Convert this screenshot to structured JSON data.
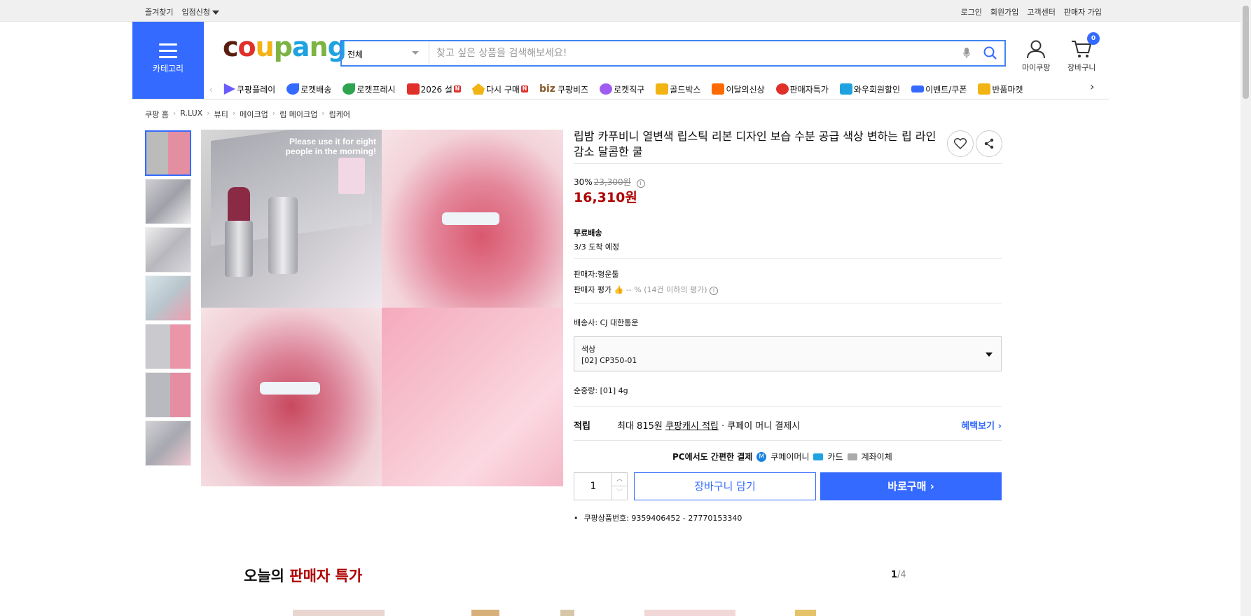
{
  "topbar": {
    "favorites": "즐겨찾기",
    "partner": "입점신청",
    "login": "로그인",
    "signup": "회원가입",
    "cs": "고객센터",
    "seller_signup": "판매자 가입"
  },
  "header": {
    "category_label": "카테고리",
    "logo": [
      "c",
      "o",
      "u",
      "p",
      "a",
      "n",
      "g"
    ],
    "search_scope": "전체",
    "search_placeholder": "찾고 싶은 상품을 검색해보세요!",
    "mycoupang": "마이쿠팡",
    "cart": "장바구니",
    "cart_count": "0"
  },
  "gnb": {
    "items": [
      {
        "label": "쿠팡플레이",
        "color": "#6a5cff"
      },
      {
        "label": "로켓배송",
        "color": "#346aff"
      },
      {
        "label": "로켓프레시",
        "color": "#2ea44f"
      },
      {
        "label": "2026 설",
        "color": "#e0302a",
        "new": "N"
      },
      {
        "label": "다시 구매",
        "color": "#f2b314",
        "new": "N"
      },
      {
        "label": "쿠팡비즈",
        "prefix": "biz",
        "color": "#8a5a2b"
      },
      {
        "label": "로켓직구",
        "color": "#a05cf0"
      },
      {
        "label": "골드박스",
        "color": "#f2b314"
      },
      {
        "label": "이달의신상",
        "color": "#ff6a00"
      },
      {
        "label": "판매자특가",
        "color": "#e0302a"
      },
      {
        "label": "와우회원할인",
        "color": "#1fa3e0"
      },
      {
        "label": "이벤트/쿠폰",
        "color": "#346aff"
      },
      {
        "label": "반품마켓",
        "color": "#f2b314"
      }
    ]
  },
  "breadcrumb": [
    "쿠팡 홈",
    "R.LUX",
    "뷰티",
    "메이크업",
    "립 메이크업",
    "립케어"
  ],
  "images": {
    "overlay_text_1": "Please use it for eight",
    "overlay_text_2": "people in the morning!"
  },
  "product": {
    "title": "립밤 카푸비니 열변색 립스틱 리본 디자인 보습 수분 공급 색상 변하는 립 라인 감소 달콤한 쿨",
    "discount": "30%",
    "original_price": "23,300원",
    "price": "16,310원",
    "shipping_title": "무료배송",
    "arrival": "3/3 도착 예정",
    "seller_label": "판매자:",
    "seller": "형운툴",
    "seller_rating_label": "판매자 평가",
    "seller_rating": "-- % (14건 이하의 평가)",
    "carrier_label": "배송사:",
    "carrier": "CJ 대한통운",
    "option_label": "색상",
    "option_value": "[02] CP350-01",
    "weight_label": "순중량:",
    "weight": "[01] 4g",
    "points_label": "적립",
    "points_text_1": "최대 815원",
    "points_text_2": "쿠팡캐시 적립",
    "points_text_3": "· 쿠페이 머니 결제시",
    "benefits": "혜택보기",
    "easy_pay": "PC에서도 간편한 결제",
    "pay_money": "쿠페이머니",
    "pay_card": "카드",
    "pay_bank": "계좌이체",
    "quantity": "1",
    "add_to_cart": "장바구니 담기",
    "buy_now": "바로구매",
    "product_id": "쿠팡상품번호: 9359406452 - 27770153340"
  },
  "deals": {
    "title_1": "오늘의",
    "title_2": "판매자 특가",
    "page": "1",
    "pages": "/4"
  }
}
